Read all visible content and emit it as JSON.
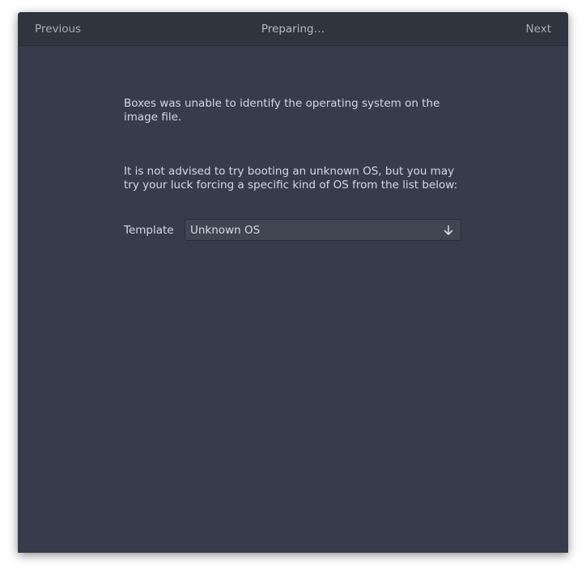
{
  "headerbar": {
    "previous_label": "Previous",
    "title": "Preparing…",
    "next_label": "Next"
  },
  "message": {
    "line1": "Boxes was unable to identify the operating system on the image file.",
    "line2": "It is not advised to try booting an unknown OS, but you may",
    "line3": "try your luck forcing a specific kind of OS from the list below:"
  },
  "template": {
    "label": "Template",
    "selected": "Unknown OS",
    "arrow_icon": "arrow-down-icon"
  },
  "colors": {
    "window_bg": "#383c4a",
    "headerbar_bg": "#2f343f",
    "text": "#d3dae3",
    "combo_bg": "#404552"
  }
}
